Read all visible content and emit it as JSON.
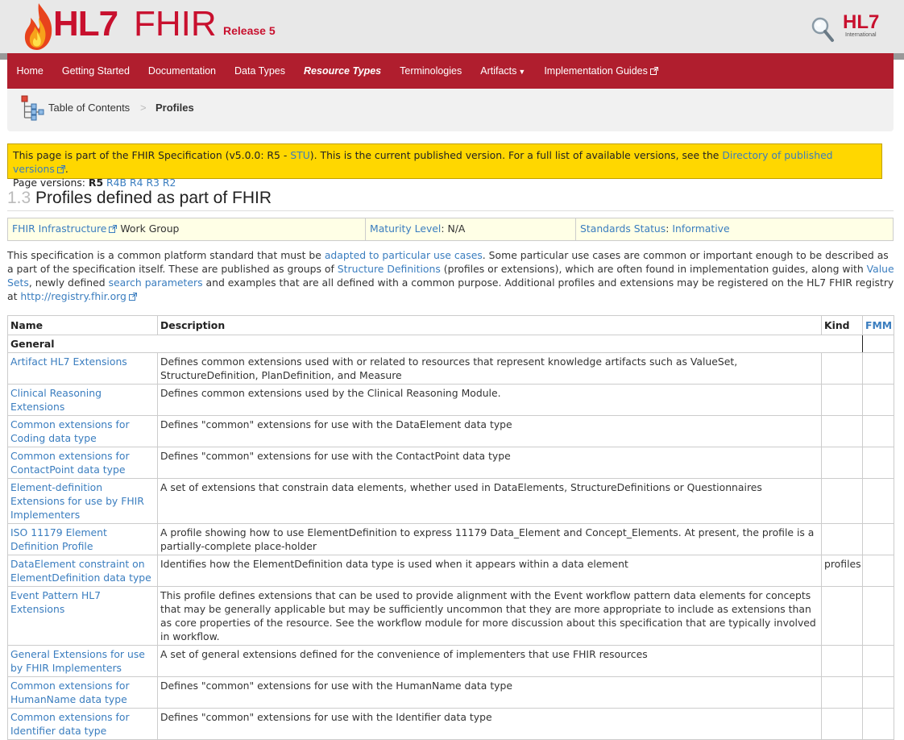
{
  "header": {
    "logo_hl7": "HL7",
    "logo_fhir": "FHIR",
    "release": "Release 5",
    "intl_logo": "HL7",
    "intl_sub": "International",
    "icons": [
      "flame-logo-icon",
      "search-icon"
    ]
  },
  "nav": {
    "items": [
      {
        "label": "Home"
      },
      {
        "label": "Getting Started"
      },
      {
        "label": "Documentation"
      },
      {
        "label": "Data Types"
      },
      {
        "label": "Resource Types",
        "active": true
      },
      {
        "label": "Terminologies"
      },
      {
        "label": "Artifacts",
        "dropdown": true
      },
      {
        "label": "Implementation Guides",
        "external": true
      }
    ],
    "bar_color": "#b01e2e"
  },
  "breadcrumb": {
    "toc": "Table of Contents",
    "separator": ">",
    "current": "Profiles"
  },
  "notice": {
    "text1": "This page is part of the FHIR Specification (v5.0.0: R5 - ",
    "stu": "STU",
    "text2": "). This is the current published version. For a full list of available versions, see the ",
    "dir_link": "Directory of published versions",
    "text3": ".",
    "versions_label": "Page versions:",
    "current_version": "R5",
    "other_versions": [
      "R4B",
      "R4",
      "R3",
      "R2"
    ],
    "bg_color": "#ffd700"
  },
  "title": {
    "number": "1.3",
    "text": "Profiles defined as part of FHIR"
  },
  "wg_bar": {
    "wg_link": "FHIR Infrastructure",
    "wg_suffix": "Work Group",
    "maturity_link": "Maturity Level",
    "maturity_value": ": N/A",
    "status_link": "Standards Status",
    "status_sep": ": ",
    "status_value": "Informative"
  },
  "intro": {
    "t1": "This specification is a common platform standard that must be ",
    "l1": "adapted to particular use cases",
    "t2": ". Some particular use cases are common or important enough to be described as a part of the specification itself. These are published as groups of ",
    "l2": "Structure Definitions",
    "t3": " (profiles or extensions), which are often found in implementation guides, along with ",
    "l3": "Value Sets",
    "t4": ", newly defined ",
    "l4": "search parameters",
    "t5": " and examples that are all defined with a common purpose. Additional profiles and extensions may be registered on the HL7 FHIR registry at ",
    "l5": "http://registry.fhir.org"
  },
  "table": {
    "headers": {
      "name": "Name",
      "description": "Description",
      "kind": "Kind",
      "fmm": "FMM"
    },
    "section": "General",
    "rows": [
      {
        "name": "Artifact HL7 Extensions",
        "description": "Defines common extensions used with or related to resources that represent knowledge artifacts such as ValueSet, StructureDefinition, PlanDefinition, and Measure",
        "kind": "",
        "fmm": ""
      },
      {
        "name": "Clinical Reasoning Extensions",
        "description": "Defines common extensions used by the Clinical Reasoning Module.",
        "kind": "",
        "fmm": ""
      },
      {
        "name": "Common extensions for Coding data type",
        "description": "Defines \"common\" extensions for use with the DataElement data type",
        "kind": "",
        "fmm": ""
      },
      {
        "name": "Common extensions for ContactPoint data type",
        "description": "Defines \"common\" extensions for use with the ContactPoint data type",
        "kind": "",
        "fmm": ""
      },
      {
        "name": "Element-definition Extensions for use by FHIR Implementers",
        "description": "A set of extensions that constrain data elements, whether used in DataElements, StructureDefinitions or Questionnaires",
        "kind": "",
        "fmm": ""
      },
      {
        "name": "ISO 11179 Element Definition Profile",
        "description": "A profile showing how to use ElementDefinition to express 11179 Data_Element and Concept_Elements. At present, the profile is a partially-complete place-holder",
        "kind": "",
        "fmm": ""
      },
      {
        "name": "DataElement constraint on ElementDefinition data type",
        "description": "Identifies how the ElementDefinition data type is used when it appears within a data element",
        "kind": "profiles",
        "fmm": ""
      },
      {
        "name": "Event Pattern HL7 Extensions",
        "description": "This profile defines extensions that can be used to provide alignment with the Event workflow pattern data elements for concepts that may be generally applicable but may be sufficiently uncommon that they are more appropriate to include as extensions than as core properties of the resource. See the workflow module for more discussion about this specification that are typically involved in workflow.",
        "kind": "",
        "fmm": ""
      },
      {
        "name": "General Extensions for use by FHIR Implementers",
        "description": "A set of general extensions defined for the convenience of implementers that use FHIR resources",
        "kind": "",
        "fmm": ""
      },
      {
        "name": "Common extensions for HumanName data type",
        "description": "Defines \"common\" extensions for use with the HumanName data type",
        "kind": "",
        "fmm": ""
      },
      {
        "name": "Common extensions for Identifier data type",
        "description": "Defines \"common\" extensions for use with the Identifier data type",
        "kind": "",
        "fmm": ""
      }
    ]
  }
}
